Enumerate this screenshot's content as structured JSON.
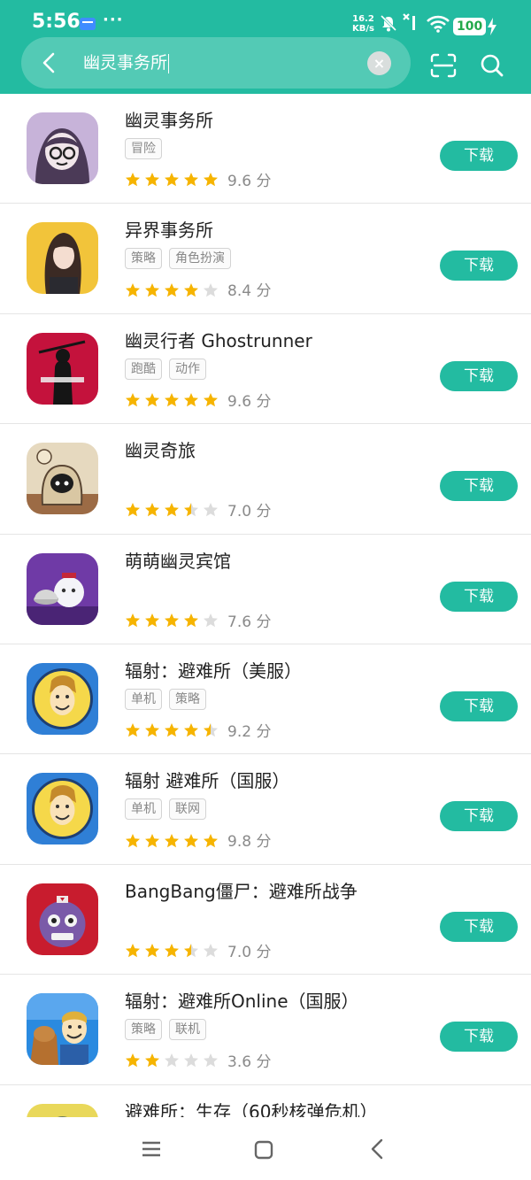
{
  "status_bar": {
    "time": "5:56",
    "more": "···",
    "net_speed_value": "16.2",
    "net_speed_unit": "KB/s",
    "battery": "100"
  },
  "search": {
    "query": "幽灵事务所"
  },
  "results": [
    {
      "title": "幽灵事务所",
      "tags": [
        "冒险"
      ],
      "rating": 9.6,
      "stars": 5,
      "score_text": "9.6 分",
      "button": "下载"
    },
    {
      "title": "异界事务所",
      "tags": [
        "策略",
        "角色扮演"
      ],
      "rating": 8.4,
      "stars": 4,
      "score_text": "8.4 分",
      "button": "下载"
    },
    {
      "title": "幽灵行者 Ghostrunner",
      "tags": [
        "跑酷",
        "动作"
      ],
      "rating": 9.6,
      "stars": 5,
      "score_text": "9.6 分",
      "button": "下载"
    },
    {
      "title": "幽灵奇旅",
      "tags": [],
      "rating": 7.0,
      "stars": 3.5,
      "score_text": "7.0 分",
      "button": "下载"
    },
    {
      "title": "萌萌幽灵宾馆",
      "tags": [],
      "rating": 7.6,
      "stars": 4,
      "score_text": "7.6 分",
      "button": "下载"
    },
    {
      "title": "辐射：避难所（美服）",
      "tags": [
        "单机",
        "策略"
      ],
      "rating": 9.2,
      "stars": 4.5,
      "score_text": "9.2 分",
      "button": "下载"
    },
    {
      "title": "辐射 避难所（国服）",
      "tags": [
        "单机",
        "联网"
      ],
      "rating": 9.8,
      "stars": 5,
      "score_text": "9.8 分",
      "button": "下载"
    },
    {
      "title": "BangBang僵尸：避难所战争",
      "tags": [],
      "rating": 7.0,
      "stars": 3.5,
      "score_text": "7.0 分",
      "button": "下载"
    },
    {
      "title": "辐射：避难所Online（国服）",
      "tags": [
        "策略",
        "联机"
      ],
      "rating": 3.6,
      "stars": 2,
      "score_text": "3.6 分",
      "button": "下载"
    },
    {
      "title": "避难所：生存（60秒核弹危机）",
      "tags": [],
      "rating": null,
      "stars": 0,
      "score_text": "",
      "button": ""
    }
  ],
  "icons": [
    "back-icon",
    "clear-icon",
    "scan-icon",
    "search-icon",
    "menu-icon",
    "home-icon",
    "nav-back-icon"
  ],
  "colors": {
    "accent": "#23bba1",
    "star_filled": "#f6b400",
    "star_empty": "#dcdcdc"
  }
}
